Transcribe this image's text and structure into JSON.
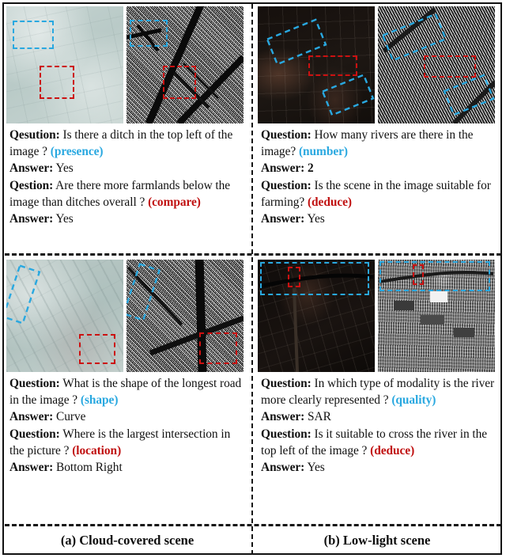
{
  "figure": {
    "panels": [
      {
        "id": "a",
        "caption": "(a) Cloud-covered scene",
        "cells": [
          {
            "id": "tl",
            "images": [
              {
                "name": "optical-cloud-covered-image",
                "modality": "optical"
              },
              {
                "name": "sar-image",
                "modality": "SAR"
              }
            ],
            "qa": [
              {
                "q_label": "Qesution:",
                "q_text": "Is there a ditch in the top left of the image ?",
                "tag": "(presence)",
                "tag_color": "#29a8e0",
                "a_label": "Answer:",
                "a_text": "Yes",
                "a_bold": false
              },
              {
                "q_label": "Qestion:",
                "q_text": "Are there more farmlands below the image than ditches overall ?",
                "tag": "(compare)",
                "tag_color": "#c01010",
                "a_label": "Answer:",
                "a_text": "Yes",
                "a_bold": false
              }
            ]
          },
          {
            "id": "bl",
            "images": [
              {
                "name": "optical-cloud-covered-image",
                "modality": "optical"
              },
              {
                "name": "sar-image",
                "modality": "SAR"
              }
            ],
            "qa": [
              {
                "q_label": "Question:",
                "q_text": "What is the shape of the longest road in the image ?",
                "tag": "(shape)",
                "tag_color": "#29a8e0",
                "a_label": "Answer:",
                "a_text": "Curve",
                "a_bold": false
              },
              {
                "q_label": "Question:",
                "q_text": "Where is the largest intersection in the picture ?",
                "tag": "(location)",
                "tag_color": "#c01010",
                "a_label": "Answer:",
                "a_text": "Bottom Right",
                "a_bold": false
              }
            ]
          }
        ]
      },
      {
        "id": "b",
        "caption": "(b) Low-light scene",
        "cells": [
          {
            "id": "tr",
            "images": [
              {
                "name": "optical-low-light-image",
                "modality": "optical"
              },
              {
                "name": "sar-image",
                "modality": "SAR"
              }
            ],
            "qa": [
              {
                "q_label": "Question:",
                "q_text": "How many rivers are there in the image?",
                "tag": "(number)",
                "tag_color": "#29a8e0",
                "a_label": "Answer:",
                "a_text": "2",
                "a_bold": true
              },
              {
                "q_label": "Question:",
                "q_text": "Is the scene in the image suitable for farming?",
                "tag": "(deduce)",
                "tag_color": "#c01010",
                "a_label": "Answer:",
                "a_text": "Yes",
                "a_bold": false
              }
            ]
          },
          {
            "id": "br",
            "images": [
              {
                "name": "optical-low-light-image",
                "modality": "optical"
              },
              {
                "name": "sar-image",
                "modality": "SAR"
              }
            ],
            "qa": [
              {
                "q_label": "Question:",
                "q_text": "In which type of modality is the river more clearly represented ?",
                "tag": "(quality)",
                "tag_color": "#29a8e0",
                "a_label": "Answer:",
                "a_text": "SAR",
                "a_bold": false
              },
              {
                "q_label": "Question:",
                "q_text": "Is it suitable to cross the river in the top left of the image ?",
                "tag": "(deduce)",
                "tag_color": "#c01010",
                "a_label": "Answer:",
                "a_text": "Yes",
                "a_bold": false
              }
            ]
          }
        ]
      }
    ],
    "colors": {
      "cyan_tag": "#29a8e0",
      "red_tag": "#c01010",
      "cyan_box": "#29a8e0",
      "red_box": "#cc1111",
      "frame": "#111111"
    }
  }
}
